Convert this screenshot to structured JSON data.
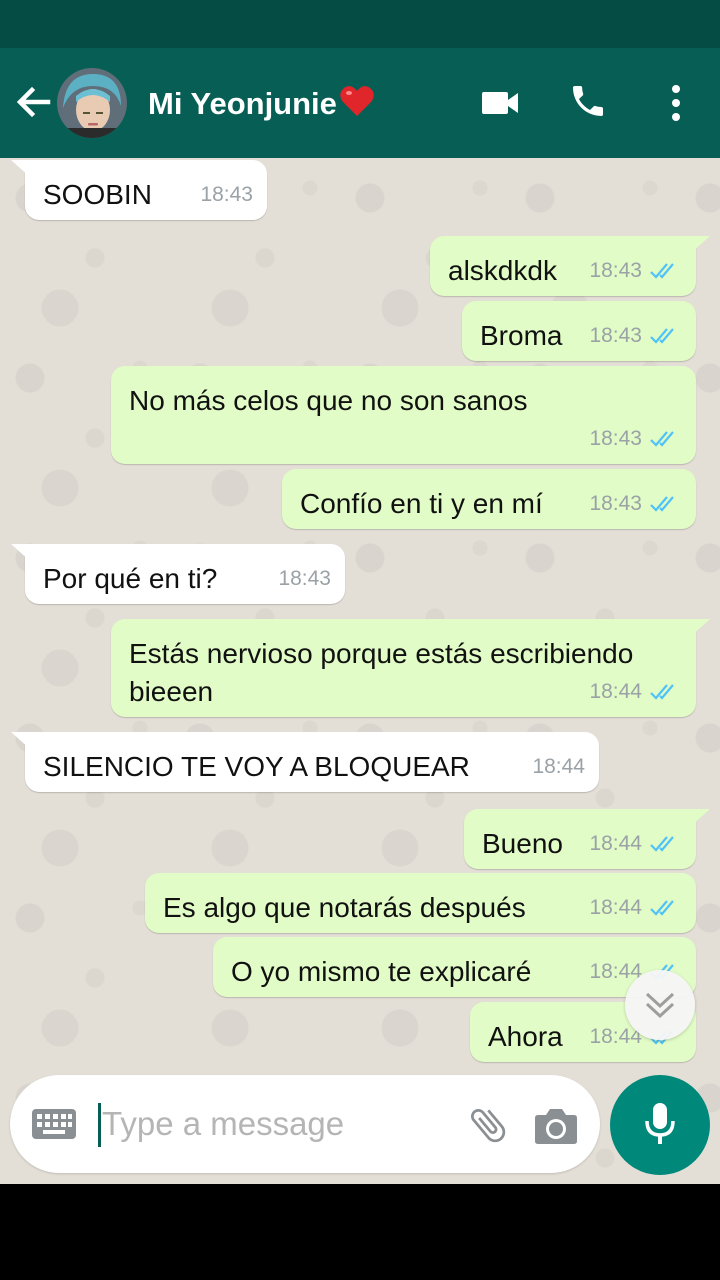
{
  "header": {
    "contact_name": "Mi Yeonjunie",
    "contact_emoji": "heart-icon",
    "icons": [
      "back-arrow-icon",
      "video-call-icon",
      "phone-icon",
      "more-vert-icon"
    ]
  },
  "messages": [
    {
      "dir": "in",
      "text": "SOOBIN",
      "time": "18:43"
    },
    {
      "dir": "out",
      "text": "alskdkdk",
      "time": "18:43",
      "read": true
    },
    {
      "dir": "out",
      "text": "Broma",
      "time": "18:43",
      "read": true
    },
    {
      "dir": "out",
      "text": "No más celos que no son sanos",
      "time": "18:43",
      "read": true
    },
    {
      "dir": "out",
      "text": "Confío en ti y en mí",
      "time": "18:43",
      "read": true
    },
    {
      "dir": "in",
      "text": "Por qué en ti?",
      "time": "18:43"
    },
    {
      "dir": "out",
      "text": "Estás nervioso porque estás escribiendo bieeen",
      "time": "18:44",
      "read": true
    },
    {
      "dir": "in",
      "text": "SILENCIO TE VOY A BLOQUEAR",
      "time": "18:44"
    },
    {
      "dir": "out",
      "text": "Bueno",
      "time": "18:44",
      "read": true
    },
    {
      "dir": "out",
      "text": "Es algo que notarás después",
      "time": "18:44",
      "read": true
    },
    {
      "dir": "out",
      "text": "O yo mismo te explicaré",
      "time": "18:44",
      "read": true
    },
    {
      "dir": "out",
      "text": "Ahora",
      "time": "18:44",
      "read": true
    }
  ],
  "composer": {
    "placeholder": "Type a message",
    "value": ""
  },
  "colors": {
    "header": "#075e54",
    "status_bar": "#054d44",
    "outgoing_bubble": "#e1fcc6",
    "incoming_bubble": "#ffffff",
    "read_ticks": "#4fc3f7",
    "mic_button": "#00897b"
  }
}
